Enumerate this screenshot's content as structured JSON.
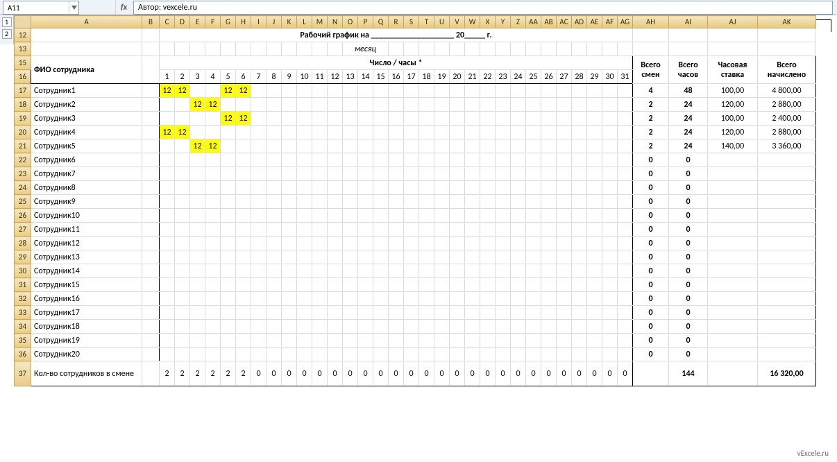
{
  "namebox": "A11",
  "fx": "fx",
  "formula": "Автор: vexcele.ru",
  "outline_levels": [
    "1",
    "2"
  ],
  "columns": [
    "A",
    "B",
    "C",
    "D",
    "E",
    "F",
    "G",
    "H",
    "I",
    "J",
    "K",
    "L",
    "M",
    "N",
    "O",
    "P",
    "Q",
    "R",
    "S",
    "T",
    "U",
    "V",
    "W",
    "X",
    "Y",
    "Z",
    "AA",
    "AB",
    "AC",
    "AD",
    "AE",
    "AF",
    "AG",
    "AH",
    "AI",
    "AJ",
    "AK"
  ],
  "rownums_top": [
    "12",
    "13"
  ],
  "title_text": "Рабочий график на ____________________ 20_____ г.",
  "title_sub": "месяц",
  "hdr_rows": [
    "15",
    "16"
  ],
  "hdr_name": "ФИО сотрудника",
  "hdr_days_caption": "Число / часы *",
  "day_nums": [
    "1",
    "2",
    "3",
    "4",
    "5",
    "6",
    "7",
    "8",
    "9",
    "10",
    "11",
    "12",
    "13",
    "14",
    "15",
    "16",
    "17",
    "18",
    "19",
    "20",
    "21",
    "22",
    "23",
    "24",
    "25",
    "26",
    "27",
    "28",
    "29",
    "30",
    "31"
  ],
  "hdr_tot_shifts": "Всего смен",
  "hdr_tot_hours": "Всего часов",
  "hdr_rate": "Часовая ставка",
  "hdr_tot_pay": "Всего начислено",
  "rows": [
    {
      "r": "17",
      "name": "Сотрудник1",
      "cells": {
        "1": "12",
        "2": "12",
        "5": "12",
        "6": "12"
      },
      "hl": [
        "1",
        "2",
        "5",
        "6"
      ],
      "shifts": "4",
      "hours": "48",
      "rate": "100,00",
      "pay": "4 800,00"
    },
    {
      "r": "18",
      "name": "Сотрудник2",
      "cells": {
        "3": "12",
        "4": "12"
      },
      "hl": [
        "3",
        "4"
      ],
      "shifts": "2",
      "hours": "24",
      "rate": "120,00",
      "pay": "2 880,00"
    },
    {
      "r": "19",
      "name": "Сотрудник3",
      "cells": {
        "5": "12",
        "6": "12"
      },
      "hl": [
        "5",
        "6"
      ],
      "shifts": "2",
      "hours": "24",
      "rate": "100,00",
      "pay": "2 400,00"
    },
    {
      "r": "20",
      "name": "Сотрудник4",
      "cells": {
        "1": "12",
        "2": "12"
      },
      "hl": [
        "1",
        "2"
      ],
      "shifts": "2",
      "hours": "24",
      "rate": "120,00",
      "pay": "2 880,00"
    },
    {
      "r": "21",
      "name": "Сотрудник5",
      "cells": {
        "3": "12",
        "4": "12"
      },
      "hl": [
        "3",
        "4"
      ],
      "shifts": "2",
      "hours": "24",
      "rate": "140,00",
      "pay": "3 360,00"
    },
    {
      "r": "22",
      "name": "Сотрудник6",
      "cells": {},
      "hl": [],
      "shifts": "0",
      "hours": "0",
      "rate": "",
      "pay": ""
    },
    {
      "r": "23",
      "name": "Сотрудник7",
      "cells": {},
      "hl": [],
      "shifts": "0",
      "hours": "0",
      "rate": "",
      "pay": ""
    },
    {
      "r": "24",
      "name": "Сотрудник8",
      "cells": {},
      "hl": [],
      "shifts": "0",
      "hours": "0",
      "rate": "",
      "pay": ""
    },
    {
      "r": "25",
      "name": "Сотрудник9",
      "cells": {},
      "hl": [],
      "shifts": "0",
      "hours": "0",
      "rate": "",
      "pay": ""
    },
    {
      "r": "26",
      "name": "Сотрудник10",
      "cells": {},
      "hl": [],
      "shifts": "0",
      "hours": "0",
      "rate": "",
      "pay": ""
    },
    {
      "r": "27",
      "name": "Сотрудник11",
      "cells": {},
      "hl": [],
      "shifts": "0",
      "hours": "0",
      "rate": "",
      "pay": ""
    },
    {
      "r": "28",
      "name": "Сотрудник12",
      "cells": {},
      "hl": [],
      "shifts": "0",
      "hours": "0",
      "rate": "",
      "pay": ""
    },
    {
      "r": "29",
      "name": "Сотрудник13",
      "cells": {},
      "hl": [],
      "shifts": "0",
      "hours": "0",
      "rate": "",
      "pay": ""
    },
    {
      "r": "30",
      "name": "Сотрудник14",
      "cells": {},
      "hl": [],
      "shifts": "0",
      "hours": "0",
      "rate": "",
      "pay": ""
    },
    {
      "r": "31",
      "name": "Сотрудник15",
      "cells": {},
      "hl": [],
      "shifts": "0",
      "hours": "0",
      "rate": "",
      "pay": ""
    },
    {
      "r": "32",
      "name": "Сотрудник16",
      "cells": {},
      "hl": [],
      "shifts": "0",
      "hours": "0",
      "rate": "",
      "pay": ""
    },
    {
      "r": "33",
      "name": "Сотрудник17",
      "cells": {},
      "hl": [],
      "shifts": "0",
      "hours": "0",
      "rate": "",
      "pay": ""
    },
    {
      "r": "34",
      "name": "Сотрудник18",
      "cells": {},
      "hl": [],
      "shifts": "0",
      "hours": "0",
      "rate": "",
      "pay": ""
    },
    {
      "r": "35",
      "name": "Сотрудник19",
      "cells": {},
      "hl": [],
      "shifts": "0",
      "hours": "0",
      "rate": "",
      "pay": ""
    },
    {
      "r": "36",
      "name": "Сотрудник20",
      "cells": {},
      "hl": [],
      "shifts": "0",
      "hours": "0",
      "rate": "",
      "pay": ""
    }
  ],
  "footer": {
    "r": "37",
    "label": "Кол-во сотрудников в смене",
    "day_counts": [
      "2",
      "2",
      "2",
      "2",
      "2",
      "2",
      "0",
      "0",
      "0",
      "0",
      "0",
      "0",
      "0",
      "0",
      "0",
      "0",
      "0",
      "0",
      "0",
      "0",
      "0",
      "0",
      "0",
      "0",
      "0",
      "0",
      "0",
      "0",
      "0",
      "0",
      "0"
    ],
    "total_hours": "144",
    "total_pay": "16 320,00"
  },
  "watermark": "vExcele.ru"
}
